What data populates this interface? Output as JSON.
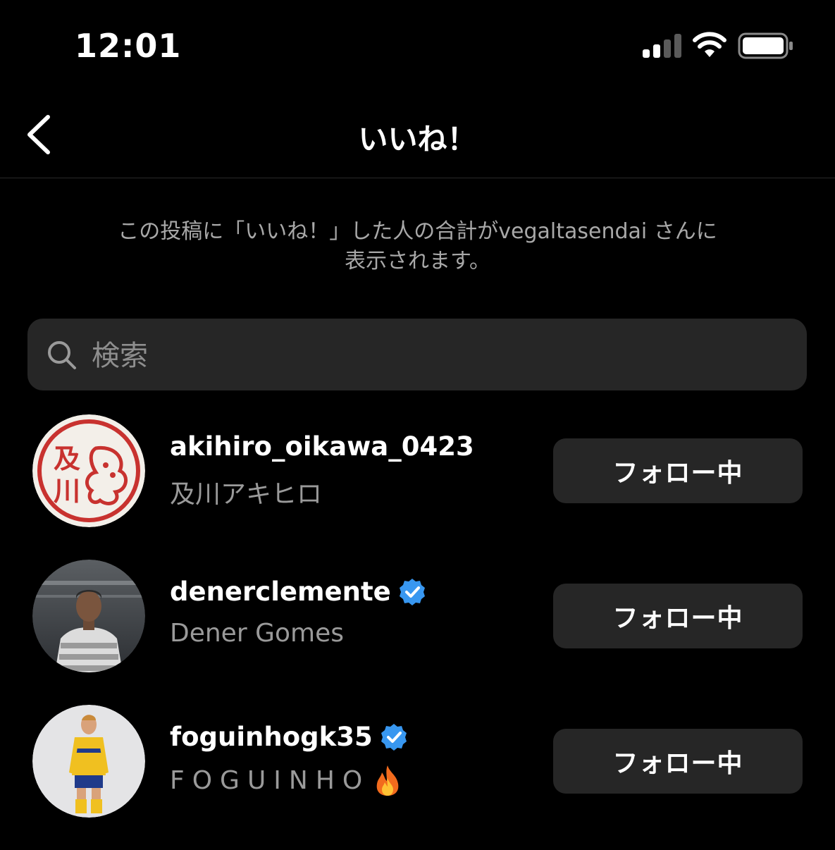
{
  "status_bar": {
    "time": "12:01",
    "icons": [
      "signal-icon",
      "wifi-icon",
      "battery-icon"
    ]
  },
  "header": {
    "back_icon": "chevron-left-icon",
    "title": "いいね！"
  },
  "info": {
    "line1": "この投稿に「いいね！」した人の合計がvegaltasendai さんに",
    "line2": "表示されます。"
  },
  "search": {
    "icon": "search-icon",
    "placeholder": "検索"
  },
  "users": [
    {
      "username": "akihiro_oikawa_0423",
      "fullname": "及川アキヒロ",
      "verified": false,
      "avatar": "hanko-stamp-avatar",
      "avatar_text": [
        "及",
        "川"
      ],
      "button_label": "フォロー中"
    },
    {
      "username": "denerclemente",
      "fullname": "Dener Gomes",
      "verified": true,
      "avatar": "player-photo-avatar",
      "button_label": "フォロー中"
    },
    {
      "username": "foguinhogk35",
      "fullname": "FOGUINHO",
      "fullname_emoji": "fire-icon",
      "verified": true,
      "avatar": "goalkeeper-photo-avatar",
      "button_label": "フォロー中"
    }
  ],
  "colors": {
    "background": "#000000",
    "button_bg": "#262626",
    "secondary_text": "#a8a8a8",
    "verified_blue": "#3897f0"
  }
}
